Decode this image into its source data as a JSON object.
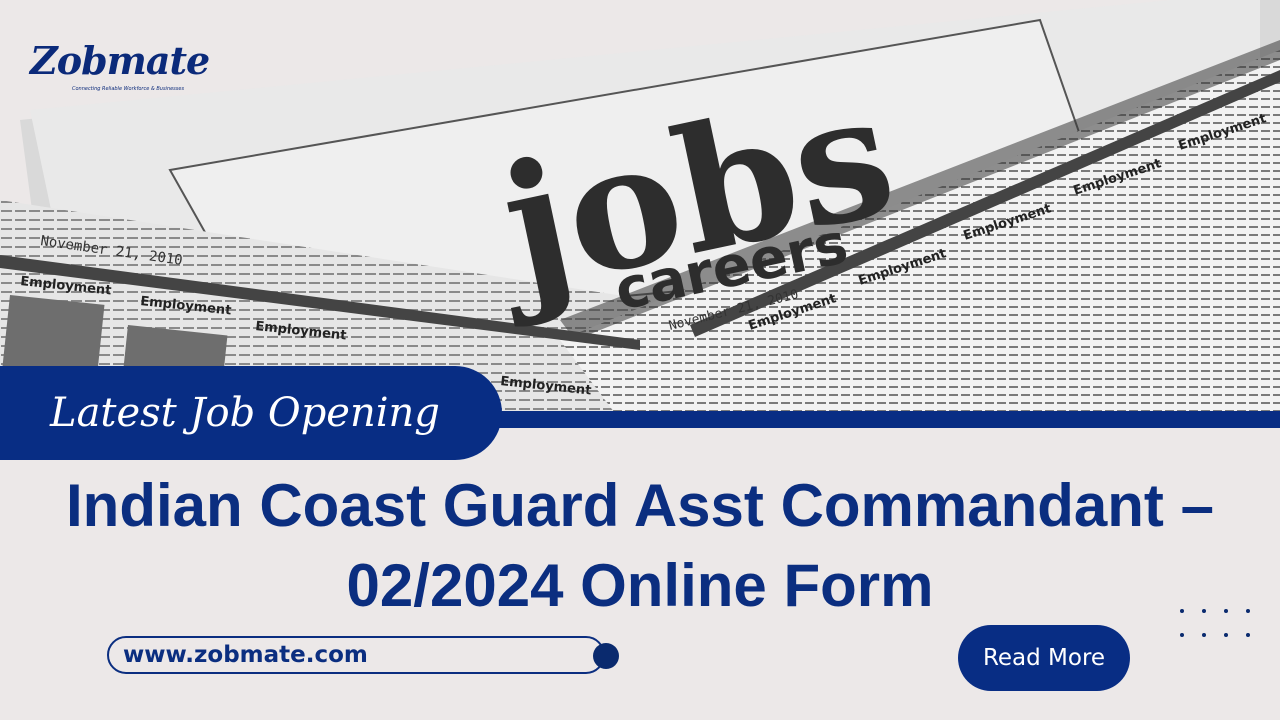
{
  "logo": {
    "name": "Zobmate",
    "tagline": "Connecting Reliable Workforce & Businesses"
  },
  "background": {
    "newspaper_heading": "jobs",
    "newspaper_subheading": "careers",
    "newspaper_date": "November 21, 2010",
    "section_label": "Employment"
  },
  "banner": {
    "label": "Latest Job Opening"
  },
  "headline": {
    "line1": "Indian Coast Guard Asst Commandant –",
    "line2": "02/2024 Online Form"
  },
  "website": {
    "url": "www.zobmate.com"
  },
  "cta": {
    "label": "Read More"
  },
  "colors": {
    "brand_blue": "#082d84",
    "text_blue": "#0b2e80",
    "background": "#ece8e8"
  }
}
